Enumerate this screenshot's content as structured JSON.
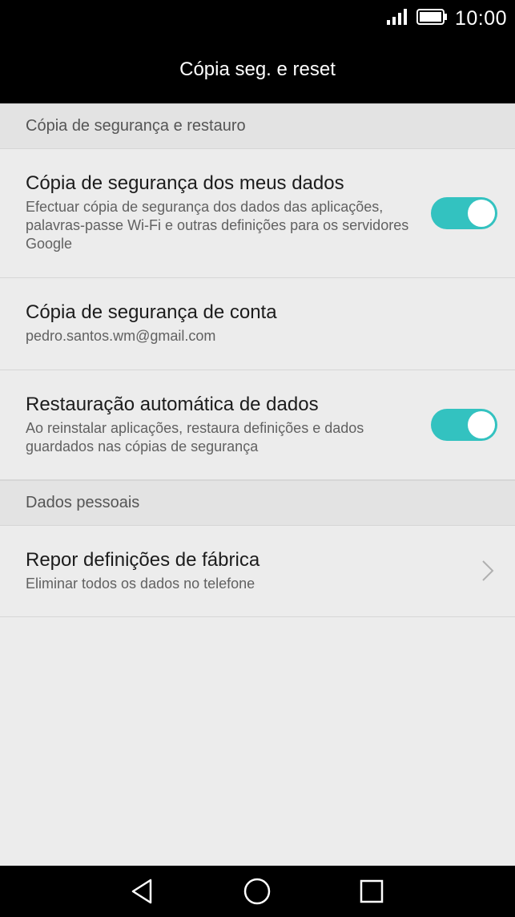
{
  "status_bar": {
    "time": "10:00",
    "signal_icon": "signal-icon",
    "battery_icon": "battery-icon"
  },
  "header": {
    "title": "Cópia seg. e reset"
  },
  "sections": [
    {
      "header": "Cópia de segurança e restauro",
      "rows": [
        {
          "title": "Cópia de segurança dos meus dados",
          "subtitle": "Efectuar cópia de segurança dos dados das aplicações, palavras-passe Wi-Fi e outras definições para os servidores Google",
          "toggle": "on"
        },
        {
          "title": "Cópia de segurança de conta",
          "subtitle": "pedro.santos.wm@gmail.com"
        },
        {
          "title": "Restauração automática de dados",
          "subtitle": "Ao reinstalar aplicações, restaura definições e dados guardados nas cópias de segurança",
          "toggle": "on"
        }
      ]
    },
    {
      "header": "Dados pessoais",
      "rows": [
        {
          "title": "Repor definições de fábrica",
          "subtitle": "Eliminar todos os dados no telefone",
          "icon": "chevron-right-icon"
        }
      ]
    }
  ],
  "nav_bar": {
    "back_icon": "back-icon",
    "home_icon": "home-icon",
    "recents_icon": "recents-icon"
  },
  "colors": {
    "accent": "#33c2c0",
    "background": "#ececec",
    "section_header": "#e3e3e3",
    "bars": "#000000"
  }
}
